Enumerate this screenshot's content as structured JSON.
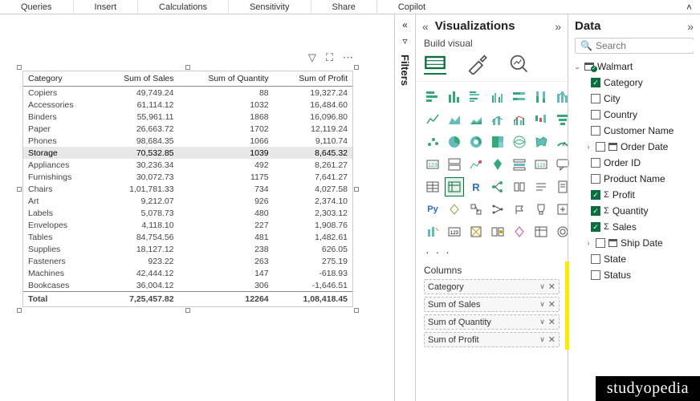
{
  "ribbon": {
    "tabs": [
      "Queries",
      "Insert",
      "Calculations",
      "Sensitivity",
      "Share",
      "Copilot"
    ]
  },
  "filters_label": "Filters",
  "viz_pane": {
    "title": "Visualizations",
    "build_label": "Build visual",
    "columns_label": "Columns",
    "wells": [
      "Category",
      "Sum of Sales",
      "Sum of Quantity",
      "Sum of Profit"
    ],
    "more": "· · ·"
  },
  "data_pane": {
    "title": "Data",
    "search_placeholder": "Search",
    "table_name": "Walmart",
    "fields": [
      {
        "label": "Category",
        "checked": true,
        "sigma": false,
        "expand": false,
        "cal": false
      },
      {
        "label": "City",
        "checked": false,
        "sigma": false,
        "expand": false,
        "cal": false
      },
      {
        "label": "Country",
        "checked": false,
        "sigma": false,
        "expand": false,
        "cal": false
      },
      {
        "label": "Customer Name",
        "checked": false,
        "sigma": false,
        "expand": false,
        "cal": false
      },
      {
        "label": "Order Date",
        "checked": false,
        "sigma": false,
        "expand": true,
        "cal": true
      },
      {
        "label": "Order ID",
        "checked": false,
        "sigma": false,
        "expand": false,
        "cal": false
      },
      {
        "label": "Product Name",
        "checked": false,
        "sigma": false,
        "expand": false,
        "cal": false
      },
      {
        "label": "Profit",
        "checked": true,
        "sigma": true,
        "expand": false,
        "cal": false
      },
      {
        "label": "Quantity",
        "checked": true,
        "sigma": true,
        "expand": false,
        "cal": false
      },
      {
        "label": "Sales",
        "checked": true,
        "sigma": true,
        "expand": false,
        "cal": false
      },
      {
        "label": "Ship Date",
        "checked": false,
        "sigma": false,
        "expand": true,
        "cal": true
      },
      {
        "label": "State",
        "checked": false,
        "sigma": false,
        "expand": false,
        "cal": false
      },
      {
        "label": "Status",
        "checked": false,
        "sigma": false,
        "expand": false,
        "cal": false
      }
    ]
  },
  "matrix": {
    "headers": [
      "Category",
      "Sum of Sales",
      "Sum of Quantity",
      "Sum of Profit"
    ],
    "rows": [
      {
        "c": "Copiers",
        "s": "49,749.24",
        "q": "88",
        "p": "19,327.24",
        "hl": false
      },
      {
        "c": "Accessories",
        "s": "61,114.12",
        "q": "1032",
        "p": "16,484.60",
        "hl": false
      },
      {
        "c": "Binders",
        "s": "55,961.11",
        "q": "1868",
        "p": "16,096.80",
        "hl": false
      },
      {
        "c": "Paper",
        "s": "26,663.72",
        "q": "1702",
        "p": "12,119.24",
        "hl": false
      },
      {
        "c": "Phones",
        "s": "98,684.35",
        "q": "1066",
        "p": "9,110.74",
        "hl": false
      },
      {
        "c": "Storage",
        "s": "70,532.85",
        "q": "1039",
        "p": "8,645.32",
        "hl": true
      },
      {
        "c": "Appliances",
        "s": "30,236.34",
        "q": "492",
        "p": "8,261.27",
        "hl": false
      },
      {
        "c": "Furnishings",
        "s": "30,072.73",
        "q": "1175",
        "p": "7,641.27",
        "hl": false
      },
      {
        "c": "Chairs",
        "s": "1,01,781.33",
        "q": "734",
        "p": "4,027.58",
        "hl": false
      },
      {
        "c": "Art",
        "s": "9,212.07",
        "q": "926",
        "p": "2,374.10",
        "hl": false
      },
      {
        "c": "Labels",
        "s": "5,078.73",
        "q": "480",
        "p": "2,303.12",
        "hl": false
      },
      {
        "c": "Envelopes",
        "s": "4,118.10",
        "q": "227",
        "p": "1,908.76",
        "hl": false
      },
      {
        "c": "Tables",
        "s": "84,754.56",
        "q": "481",
        "p": "1,482.61",
        "hl": false
      },
      {
        "c": "Supplies",
        "s": "18,127.12",
        "q": "238",
        "p": "626.05",
        "hl": false
      },
      {
        "c": "Fasteners",
        "s": "923.22",
        "q": "263",
        "p": "275.19",
        "hl": false
      },
      {
        "c": "Machines",
        "s": "42,444.12",
        "q": "147",
        "p": "-618.93",
        "hl": false
      },
      {
        "c": "Bookcases",
        "s": "36,004.12",
        "q": "306",
        "p": "-1,646.51",
        "hl": false
      }
    ],
    "total": {
      "label": "Total",
      "s": "7,25,457.82",
      "q": "12264",
      "p": "1,08,418.45"
    }
  },
  "chart_data": {
    "type": "table",
    "columns": [
      "Category",
      "Sum of Sales",
      "Sum of Quantity",
      "Sum of Profit"
    ],
    "rows": [
      [
        "Copiers",
        49749.24,
        88,
        19327.24
      ],
      [
        "Accessories",
        61114.12,
        1032,
        16484.6
      ],
      [
        "Binders",
        55961.11,
        1868,
        16096.8
      ],
      [
        "Paper",
        26663.72,
        1702,
        12119.24
      ],
      [
        "Phones",
        98684.35,
        1066,
        9110.74
      ],
      [
        "Storage",
        70532.85,
        1039,
        8645.32
      ],
      [
        "Appliances",
        30236.34,
        492,
        8261.27
      ],
      [
        "Furnishings",
        30072.73,
        1175,
        7641.27
      ],
      [
        "Chairs",
        101781.33,
        734,
        4027.58
      ],
      [
        "Art",
        9212.07,
        926,
        2374.1
      ],
      [
        "Labels",
        5078.73,
        480,
        2303.12
      ],
      [
        "Envelopes",
        4118.1,
        227,
        1908.76
      ],
      [
        "Tables",
        84754.56,
        481,
        1482.61
      ],
      [
        "Supplies",
        18127.12,
        238,
        626.05
      ],
      [
        "Fasteners",
        923.22,
        263,
        275.19
      ],
      [
        "Machines",
        42444.12,
        147,
        -618.93
      ],
      [
        "Bookcases",
        36004.12,
        306,
        -1646.51
      ]
    ],
    "total": [
      "Total",
      725457.82,
      12264,
      108418.45
    ]
  },
  "watermark": "studyopedia"
}
